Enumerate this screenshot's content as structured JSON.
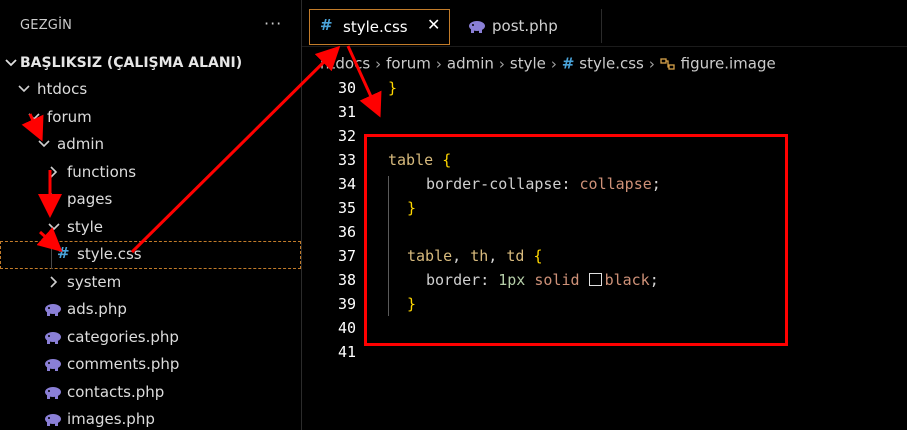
{
  "sidebar": {
    "title": "GEZGİN",
    "more": "···",
    "root": "BAŞLIKSIZ (ÇALIŞMA ALANI)",
    "items": [
      {
        "label": "htdocs"
      },
      {
        "label": "forum"
      },
      {
        "label": "admin"
      },
      {
        "label": "functions"
      },
      {
        "label": "pages"
      },
      {
        "label": "style"
      },
      {
        "label": "style.css"
      },
      {
        "label": "system"
      },
      {
        "label": "ads.php"
      },
      {
        "label": "categories.php"
      },
      {
        "label": "comments.php"
      },
      {
        "label": "contacts.php"
      },
      {
        "label": "images.php"
      }
    ]
  },
  "tabs": [
    {
      "label": "style.css",
      "icon": "#",
      "close": "✕"
    },
    {
      "label": "post.php"
    }
  ],
  "breadcrumb": {
    "items": [
      "htdocs",
      "forum",
      "admin",
      "style"
    ],
    "file": "style.css",
    "file_icon": "#",
    "symbol": "figure.image"
  },
  "editor": {
    "lines": [
      {
        "n": "30",
        "code": "}"
      },
      {
        "n": "31",
        "code": ""
      },
      {
        "n": "32",
        "code": ""
      },
      {
        "n": "33",
        "code": "table {"
      },
      {
        "n": "34",
        "code": "  border-collapse: collapse;"
      },
      {
        "n": "35",
        "code": "}"
      },
      {
        "n": "36",
        "code": ""
      },
      {
        "n": "37",
        "code": "table, th, td {"
      },
      {
        "n": "38",
        "code": "  border: 1px solid black;"
      },
      {
        "n": "39",
        "code": "}"
      },
      {
        "n": "40",
        "code": ""
      },
      {
        "n": "41",
        "code": ""
      }
    ],
    "tokens": {
      "table": "table",
      "brace_open": "{",
      "brace_close": "}",
      "prop_bc": "border-collapse",
      "val_collapse": "collapse",
      "sel_th": "th",
      "sel_td": "td",
      "prop_border": "border",
      "num_1px": "1px",
      "val_solid": "solid",
      "val_black": "black",
      "colon": ":",
      "semi": ";",
      "comma": ","
    }
  },
  "colors": {
    "annotation": "#ff0000",
    "selection_outline": "#c37c2a",
    "css_icon": "#4aa3d9",
    "php_icon": "#8a7fd6"
  }
}
